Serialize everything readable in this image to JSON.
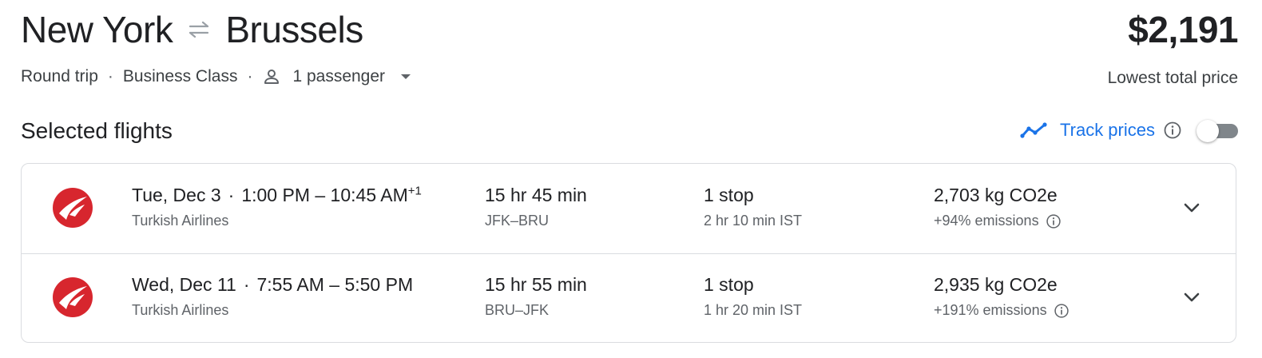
{
  "header": {
    "origin": "New York",
    "destination": "Brussels",
    "price": "$2,191",
    "price_label": "Lowest total price"
  },
  "options": {
    "trip_type": "Round trip",
    "separator": "·",
    "cabin": "Business Class",
    "passengers": "1 passenger"
  },
  "section": {
    "title": "Selected flights",
    "track_label": "Track prices",
    "track_enabled": false
  },
  "colors": {
    "accent": "#1a73e8",
    "airline_red": "#d7262e"
  },
  "flights": [
    {
      "date": "Tue, Dec 3",
      "times": "1:00 PM – 10:45 AM",
      "day_offset": "+1",
      "airline": "Turkish Airlines",
      "duration": "15 hr 45 min",
      "route": "JFK–BRU",
      "stops": "1 stop",
      "layover": "2 hr 10 min IST",
      "emissions": "2,703 kg CO2e",
      "emissions_delta": "+94% emissions"
    },
    {
      "date": "Wed, Dec 11",
      "times": "7:55 AM – 5:50 PM",
      "day_offset": "",
      "airline": "Turkish Airlines",
      "duration": "15 hr 55 min",
      "route": "BRU–JFK",
      "stops": "1 stop",
      "layover": "1 hr 20 min IST",
      "emissions": "2,935 kg CO2e",
      "emissions_delta": "+191% emissions"
    }
  ]
}
